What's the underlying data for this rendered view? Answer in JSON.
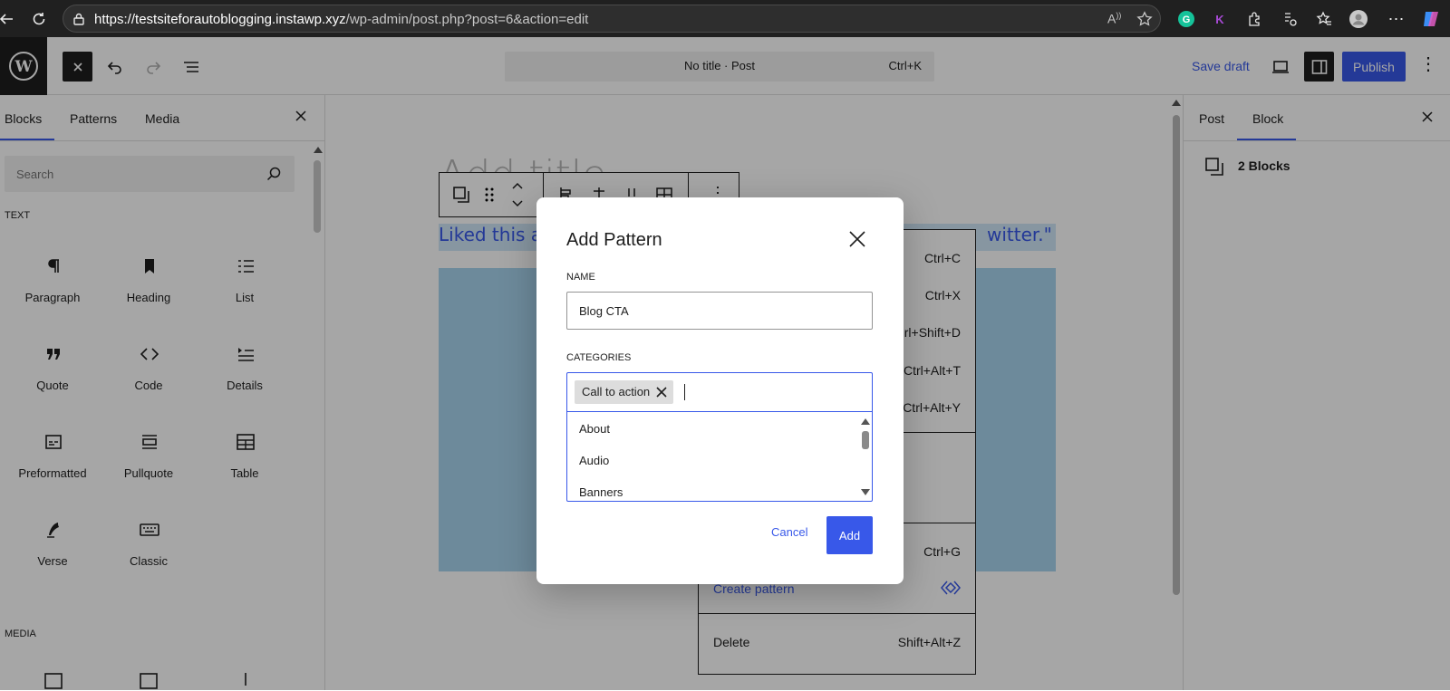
{
  "browser": {
    "url_host": "https://testsiteforautoblogging.instawp.xyz",
    "url_path": "/wp-admin/post.php?post=6&action=edit"
  },
  "toolbar": {
    "document_title": "No title · Post",
    "command_shortcut": "Ctrl+K",
    "save_draft_label": "Save draft",
    "publish_label": "Publish"
  },
  "inserter": {
    "tabs": [
      "Blocks",
      "Patterns",
      "Media"
    ],
    "search_placeholder": "Search",
    "sections": {
      "text": "TEXT",
      "media": "MEDIA"
    },
    "blocks": [
      {
        "label": "Paragraph",
        "icon": "paragraph-icon"
      },
      {
        "label": "Heading",
        "icon": "heading-icon"
      },
      {
        "label": "List",
        "icon": "list-icon"
      },
      {
        "label": "Quote",
        "icon": "quote-icon"
      },
      {
        "label": "Code",
        "icon": "code-icon"
      },
      {
        "label": "Details",
        "icon": "details-icon"
      },
      {
        "label": "Preformatted",
        "icon": "preformatted-icon"
      },
      {
        "label": "Pullquote",
        "icon": "pullquote-icon"
      },
      {
        "label": "Table",
        "icon": "table-icon"
      },
      {
        "label": "Verse",
        "icon": "verse-icon"
      },
      {
        "label": "Classic",
        "icon": "classic-icon"
      }
    ]
  },
  "canvas": {
    "title_placeholder": "Add title",
    "selected_text_start": "Liked this a",
    "selected_text_end": "witter.\""
  },
  "context_menu": {
    "shortcuts": [
      "Ctrl+C",
      "Ctrl+X",
      "rl+Shift+D",
      "Ctrl+Alt+T",
      "Ctrl+Alt+Y",
      "Ctrl+G"
    ],
    "create_pattern_label": "Create pattern",
    "delete_label": "Delete",
    "delete_shortcut": "Shift+Alt+Z"
  },
  "settings": {
    "tabs": [
      "Post",
      "Block"
    ],
    "block_count": "2 Blocks"
  },
  "modal": {
    "title": "Add Pattern",
    "name_label": "NAME",
    "name_value": "Blog CTA",
    "categories_label": "CATEGORIES",
    "selected_token": "Call to action",
    "options": [
      "About",
      "Audio",
      "Banners"
    ],
    "cancel_label": "Cancel",
    "add_label": "Add"
  },
  "colors": {
    "accent": "#3858e9",
    "selection_bg": "#cfe6f8",
    "block_bg": "#a8d4ef"
  }
}
